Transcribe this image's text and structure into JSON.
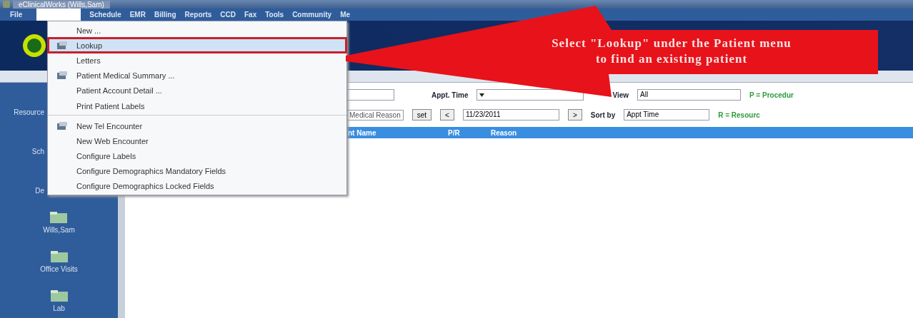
{
  "window": {
    "title": "eClinicalWorks (Wills,Sam)"
  },
  "menu_bar": [
    {
      "label": "File",
      "selected": false
    },
    {
      "label": "Schedule",
      "selected": false
    },
    {
      "label": "EMR",
      "selected": false
    },
    {
      "label": "Billing",
      "selected": false
    },
    {
      "label": "Reports",
      "selected": false
    },
    {
      "label": "CCD",
      "selected": false
    },
    {
      "label": "Fax",
      "selected": false
    },
    {
      "label": "Tools",
      "selected": false
    },
    {
      "label": "Community",
      "selected": false
    },
    {
      "label": "Me",
      "selected": false
    }
  ],
  "patient_menu": {
    "items": [
      {
        "label": "New ...",
        "selected": false,
        "icon": false,
        "separator_after": false
      },
      {
        "label": "Lookup",
        "selected": true,
        "icon": true,
        "separator_after": false
      },
      {
        "label": "Letters",
        "selected": false,
        "icon": false,
        "separator_after": false
      },
      {
        "label": "Patient Medical Summary ...",
        "selected": false,
        "icon": true,
        "separator_after": false
      },
      {
        "label": "Patient Account Detail ...",
        "selected": false,
        "icon": false,
        "separator_after": false
      },
      {
        "label": "Print Patient Labels",
        "selected": false,
        "icon": false,
        "separator_after": true
      },
      {
        "label": "New Tel Encounter",
        "selected": false,
        "icon": true,
        "separator_after": false
      },
      {
        "label": "New Web Encounter",
        "selected": false,
        "icon": false,
        "separator_after": false
      },
      {
        "label": "Configure Labels",
        "selected": false,
        "icon": false,
        "separator_after": false
      },
      {
        "label": "Configure Demographics Mandatory Fields",
        "selected": false,
        "icon": false,
        "separator_after": false
      },
      {
        "label": "Configure Demographics Locked Fields",
        "selected": false,
        "icon": false,
        "separator_after": false
      }
    ]
  },
  "callout": {
    "text": "Select \"Lookup\" under the Patient menu to find an existing patient"
  },
  "sidebar": {
    "items": [
      {
        "label": "Resource",
        "covered": true,
        "icon": false
      },
      {
        "label": "Sch",
        "covered": true,
        "icon": false
      },
      {
        "label": "De",
        "covered": true,
        "icon": false
      },
      {
        "label": "Wills,Sam",
        "covered": false,
        "icon": true
      },
      {
        "label": "Office Visits",
        "covered": false,
        "icon": true
      },
      {
        "label": "Lab",
        "covered": false,
        "icon": true
      }
    ]
  },
  "toolbar": {
    "appt_time_label": "Appt. Time",
    "view_label": "View",
    "view_value": "All",
    "legend_p": "P = Procedur",
    "reason_field": "Medical Reason",
    "set_button": "set",
    "prev_button": "<",
    "date_value": "11/23/2011",
    "next_button": ">",
    "sort_label": "Sort by",
    "sort_value": "Appt Time",
    "legend_r": "R = Resourc"
  },
  "table": {
    "columns": [
      "nt Name",
      "P/R",
      "Reason"
    ]
  }
}
